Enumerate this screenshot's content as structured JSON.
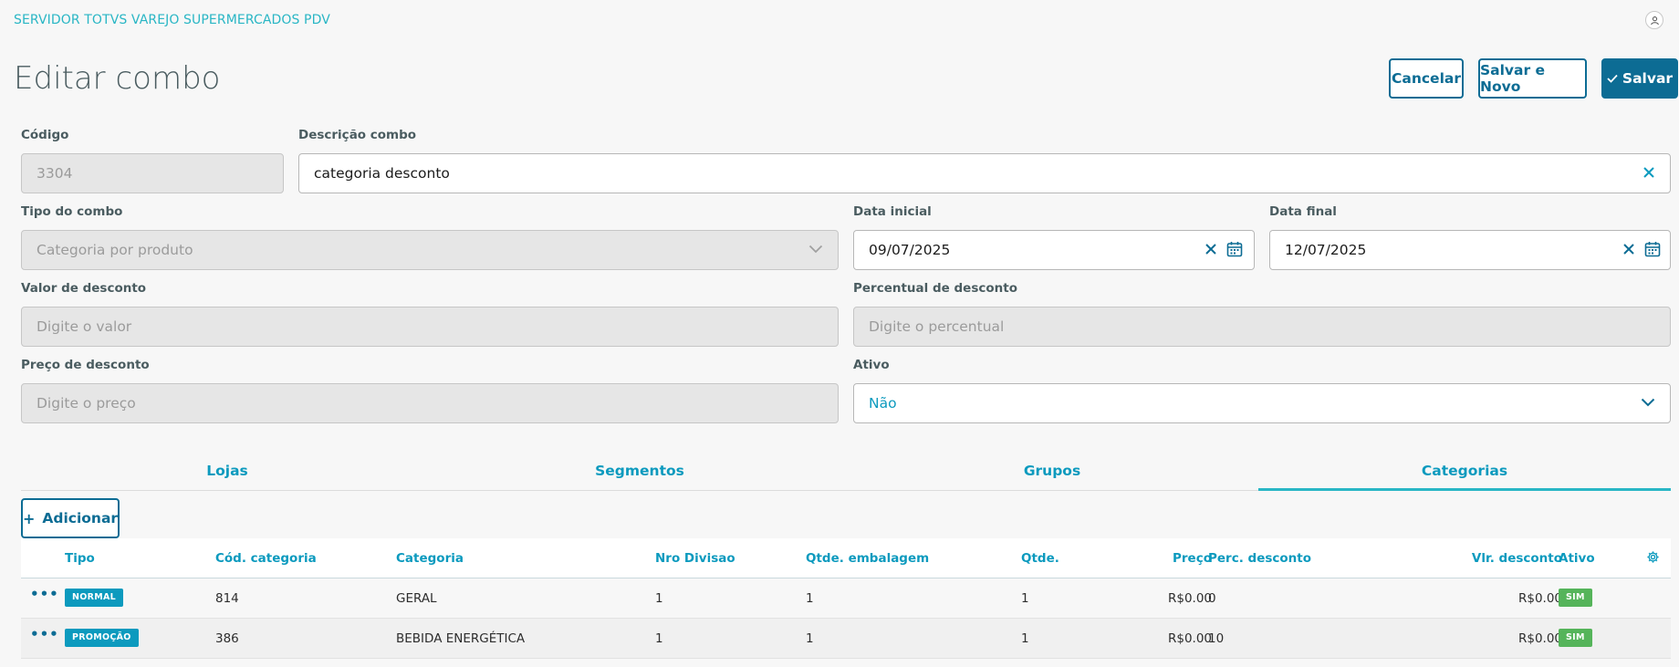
{
  "app": {
    "title": "SERVIDOR TOTVS VAREJO SUPERMERCADOS PDV"
  },
  "header": {
    "user_icon": "user-icon"
  },
  "page": {
    "title": "Editar combo"
  },
  "actions": {
    "cancel": "Cancelar",
    "save_new": "Salvar e Novo",
    "save": "Salvar"
  },
  "form": {
    "codigo": {
      "label": "Código",
      "value": "3304"
    },
    "descricao": {
      "label": "Descrição combo",
      "value": "categoria desconto"
    },
    "tipo": {
      "label": "Tipo do combo",
      "value": "Categoria por produto"
    },
    "data_inicial": {
      "label": "Data inicial",
      "value": "09/07/2025"
    },
    "data_final": {
      "label": "Data final",
      "value": "12/07/2025"
    },
    "valor_desconto": {
      "label": "Valor de desconto",
      "placeholder": "Digite o valor"
    },
    "percentual_desconto": {
      "label": "Percentual de desconto",
      "placeholder": "Digite o percentual"
    },
    "preco_desconto": {
      "label": "Preço de desconto",
      "placeholder": "Digite o preço"
    },
    "ativo": {
      "label": "Ativo",
      "value": "Não"
    }
  },
  "tabs": [
    {
      "label": "Lojas",
      "active": false
    },
    {
      "label": "Segmentos",
      "active": false
    },
    {
      "label": "Grupos",
      "active": false
    },
    {
      "label": "Categorias",
      "active": true
    }
  ],
  "table": {
    "add_label": "Adicionar",
    "columns": {
      "tipo": "Tipo",
      "cod": "Cód. categoria",
      "categoria": "Categoria",
      "divisao": "Nro Divisao",
      "embalagem": "Qtde. embalagem",
      "qtde": "Qtde.",
      "preco": "Preço",
      "perc": "Perc. desconto",
      "vlr": "Vlr. desconto",
      "ativo": "Ativo"
    },
    "rows": [
      {
        "tipo": "NORMAL",
        "cod": "814",
        "categoria": "GERAL",
        "divisao": "1",
        "embalagem": "1",
        "qtde": "1",
        "preco": "R$0.00",
        "perc": "0",
        "vlr": "R$0.00",
        "ativo": "SIM"
      },
      {
        "tipo": "PROMOÇÃO",
        "cod": "386",
        "categoria": "BEBIDA ENERGÉTICA",
        "divisao": "1",
        "embalagem": "1",
        "qtde": "1",
        "preco": "R$0.00",
        "perc": "10",
        "vlr": "R$0.00",
        "ativo": "SIM"
      }
    ]
  },
  "colors": {
    "accent": "#0c6c94",
    "link": "#0c9abe",
    "teal": "#29b6c5",
    "success": "#55b45a"
  }
}
